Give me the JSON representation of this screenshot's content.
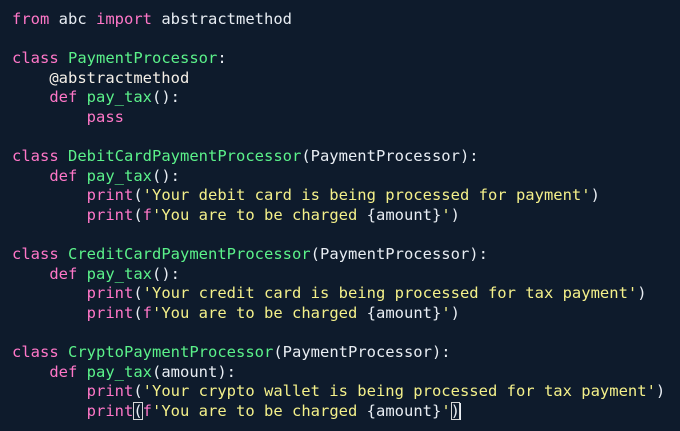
{
  "editor": {
    "lines": [
      [
        {
          "t": "from",
          "c": "kw"
        },
        {
          "t": " abc ",
          "c": "plain"
        },
        {
          "t": "import",
          "c": "kw"
        },
        {
          "t": " abstractmethod",
          "c": "plain"
        }
      ],
      [],
      [
        {
          "t": "class",
          "c": "kw"
        },
        {
          "t": " ",
          "c": "plain"
        },
        {
          "t": "PaymentProcessor",
          "c": "cls"
        },
        {
          "t": ":",
          "c": "plain"
        }
      ],
      [
        {
          "t": "    ",
          "c": "plain"
        },
        {
          "t": "@abstractmethod",
          "c": "dec"
        }
      ],
      [
        {
          "t": "    ",
          "c": "plain"
        },
        {
          "t": "def",
          "c": "kw"
        },
        {
          "t": " ",
          "c": "plain"
        },
        {
          "t": "pay_tax",
          "c": "fn"
        },
        {
          "t": "():",
          "c": "plain"
        }
      ],
      [
        {
          "t": "        ",
          "c": "plain"
        },
        {
          "t": "pass",
          "c": "kw"
        }
      ],
      [],
      [
        {
          "t": "class",
          "c": "kw"
        },
        {
          "t": " ",
          "c": "plain"
        },
        {
          "t": "DebitCardPaymentProcessor",
          "c": "cls"
        },
        {
          "t": "(PaymentProcessor):",
          "c": "plain"
        }
      ],
      [
        {
          "t": "    ",
          "c": "plain"
        },
        {
          "t": "def",
          "c": "kw"
        },
        {
          "t": " ",
          "c": "plain"
        },
        {
          "t": "pay_tax",
          "c": "fn"
        },
        {
          "t": "():",
          "c": "plain"
        }
      ],
      [
        {
          "t": "        ",
          "c": "plain"
        },
        {
          "t": "print",
          "c": "builtin"
        },
        {
          "t": "(",
          "c": "plain"
        },
        {
          "t": "'Your debit card is being processed for payment'",
          "c": "str"
        },
        {
          "t": ")",
          "c": "plain"
        }
      ],
      [
        {
          "t": "        ",
          "c": "plain"
        },
        {
          "t": "print",
          "c": "builtin"
        },
        {
          "t": "(",
          "c": "plain"
        },
        {
          "t": "f",
          "c": "kw"
        },
        {
          "t": "'You are to be charged ",
          "c": "str"
        },
        {
          "t": "{amount}",
          "c": "plain"
        },
        {
          "t": "'",
          "c": "str"
        },
        {
          "t": ")",
          "c": "plain"
        }
      ],
      [],
      [
        {
          "t": "class",
          "c": "kw"
        },
        {
          "t": " ",
          "c": "plain"
        },
        {
          "t": "CreditCardPaymentProcessor",
          "c": "cls"
        },
        {
          "t": "(PaymentProcessor):",
          "c": "plain"
        }
      ],
      [
        {
          "t": "    ",
          "c": "plain"
        },
        {
          "t": "def",
          "c": "kw"
        },
        {
          "t": " ",
          "c": "plain"
        },
        {
          "t": "pay_tax",
          "c": "fn"
        },
        {
          "t": "():",
          "c": "plain"
        }
      ],
      [
        {
          "t": "        ",
          "c": "plain"
        },
        {
          "t": "print",
          "c": "builtin"
        },
        {
          "t": "(",
          "c": "plain"
        },
        {
          "t": "'Your credit card is being processed for tax payment'",
          "c": "str"
        },
        {
          "t": ")",
          "c": "plain"
        }
      ],
      [
        {
          "t": "        ",
          "c": "plain"
        },
        {
          "t": "print",
          "c": "builtin"
        },
        {
          "t": "(",
          "c": "plain"
        },
        {
          "t": "f",
          "c": "kw"
        },
        {
          "t": "'You are to be charged ",
          "c": "str"
        },
        {
          "t": "{amount}",
          "c": "plain"
        },
        {
          "t": "'",
          "c": "str"
        },
        {
          "t": ")",
          "c": "plain"
        }
      ],
      [],
      [
        {
          "t": "class",
          "c": "kw"
        },
        {
          "t": " ",
          "c": "plain"
        },
        {
          "t": "CryptoPaymentProcessor",
          "c": "cls"
        },
        {
          "t": "(PaymentProcessor):",
          "c": "plain"
        }
      ],
      [
        {
          "t": "    ",
          "c": "plain"
        },
        {
          "t": "def",
          "c": "kw"
        },
        {
          "t": " ",
          "c": "plain"
        },
        {
          "t": "pay_tax",
          "c": "fn"
        },
        {
          "t": "(amount):",
          "c": "plain"
        }
      ],
      [
        {
          "t": "        ",
          "c": "plain"
        },
        {
          "t": "print",
          "c": "builtin"
        },
        {
          "t": "(",
          "c": "plain"
        },
        {
          "t": "'Your crypto wallet is being processed for tax payment'",
          "c": "str"
        },
        {
          "t": ")",
          "c": "plain"
        }
      ],
      [
        {
          "t": "        ",
          "c": "plain"
        },
        {
          "t": "print",
          "c": "builtin"
        },
        {
          "t": "(",
          "c": "plain",
          "m": true
        },
        {
          "t": "f",
          "c": "kw"
        },
        {
          "t": "'You are to be charged ",
          "c": "str"
        },
        {
          "t": "{amount}",
          "c": "plain"
        },
        {
          "t": "'",
          "c": "str"
        },
        {
          "t": ")",
          "c": "plain",
          "m": true
        },
        {
          "cursor": true
        }
      ]
    ]
  },
  "colors": {
    "background": "#0e1b2c",
    "keyword": "#ff77c8",
    "class_name": "#5bf28a",
    "string": "#f4f08a",
    "text": "#e8edf3"
  }
}
